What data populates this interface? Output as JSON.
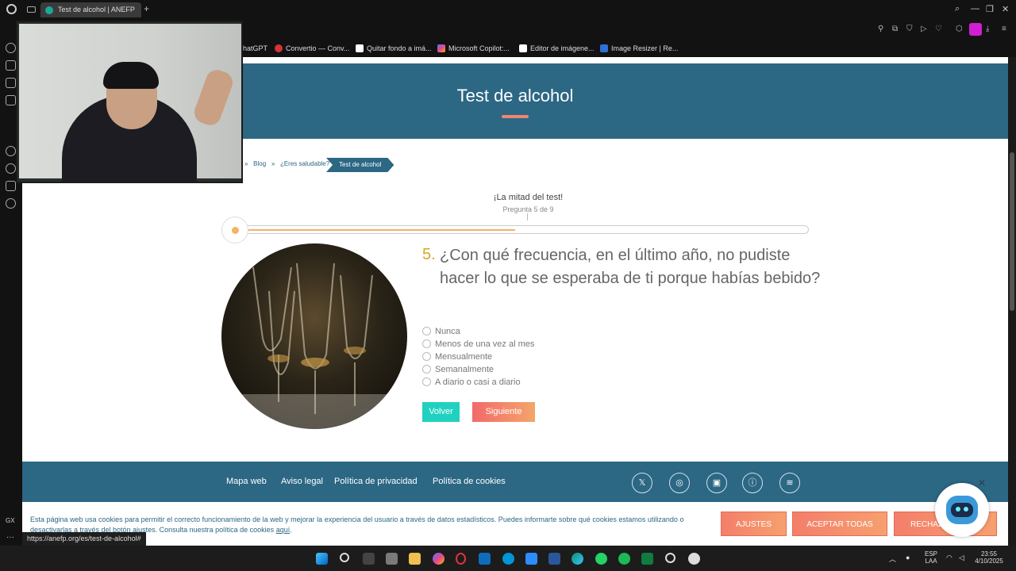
{
  "browser": {
    "tab_title": "Test de alcohol | ANEFP",
    "tab_add_icon": "+",
    "bookmarks": [
      "hatGPT",
      "Convertio — Conv...",
      "Quitar fondo a imá...",
      "Microsoft Copilot:...",
      "Editor de imágene...",
      "Image Resizer | Re..."
    ],
    "status_url": "https://anefp.org/es/test-de-alcohol#",
    "sidebar_label": "GX"
  },
  "hero": {
    "title": "Test de alcohol"
  },
  "breadcrumb": {
    "blog": "Blog",
    "sep": "»",
    "section": "¿Eres saludable?",
    "current": "Test de alcohol"
  },
  "progress": {
    "title": "¡La mitad del test!",
    "subtitle": "Pregunta 5 de 9",
    "fraction": 0.5
  },
  "question": {
    "number": "5.",
    "text": "¿Con qué frecuencia, en el último año, no pudiste hacer lo que se esperaba de ti porque habías bebido?",
    "options": [
      "Nunca",
      "Menos de una vez al mes",
      "Mensualmente",
      "Semanalmente",
      "A diario o casi a diario"
    ],
    "back_label": "Volver",
    "next_label": "Siguiente"
  },
  "footer": {
    "links": [
      "Mapa web",
      "Aviso legal",
      "Política de privacidad",
      "Política de cookies"
    ],
    "social": [
      "x-icon",
      "instagram-icon",
      "linkedin-icon",
      "info-icon",
      "spotify-icon"
    ]
  },
  "cookie": {
    "text": "Esta página web usa cookies para permitir el correcto funcionamiento de la web y mejorar la experiencia del usuario a través de datos estadísticos. Puedes informarte sobre qué cookies estamos utilizando o desactivarlas a través del botón ajustes. Consulta nuestra política de cookies ",
    "link": "aquí",
    "settings_label": "AJUSTES",
    "accept_label": "ACEPTAR TODAS",
    "reject_label": "RECHAZ"
  },
  "taskbar": {
    "lang1": "ESP",
    "lang2": "LAA",
    "time": "23:55",
    "date": "4/10/2025"
  },
  "colors": {
    "brand": "#2c6784",
    "accent": "#f2b466",
    "teal": "#21d1bf",
    "coral": "#f26a6a"
  }
}
